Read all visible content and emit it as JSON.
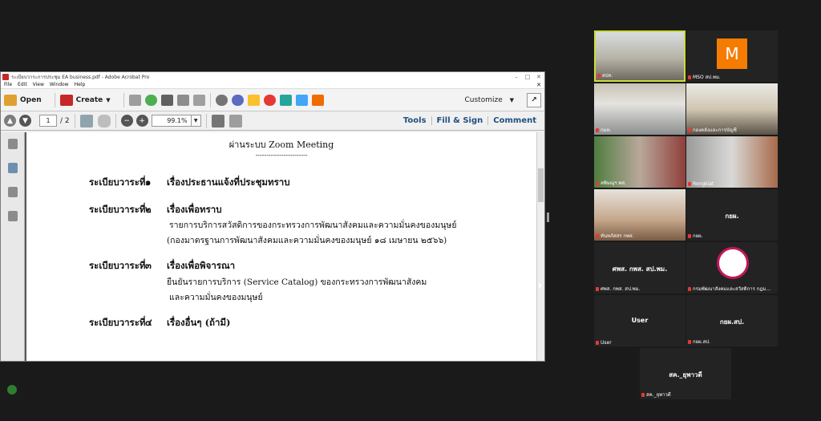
{
  "acrobat": {
    "title": "ระเบียบวาระการประชุม EA business.pdf - Adobe Acrobat Pro",
    "menu": [
      "File",
      "Edit",
      "View",
      "Window",
      "Help"
    ],
    "open_label": "Open",
    "create_label": "Create",
    "customize_label": "Customize",
    "page_current": "1",
    "page_total": "/ 2",
    "zoom": "99.1%",
    "tools_label": "Tools",
    "fillsign_label": "Fill & Sign",
    "comment_label": "Comment"
  },
  "document": {
    "heading": "ผ่านระบบ Zoom  Meeting",
    "dashes": "------------------------",
    "agenda": [
      {
        "label": "ระเบียบวาระที่",
        "num": "๑",
        "title": "เรื่องประธานแจ้งที่ประชุมทราบ",
        "details": []
      },
      {
        "label": "ระเบียบวาระที่",
        "num": "๒",
        "title": "เรื่องเพื่อทราบ",
        "details": [
          "รายการบริการสวัสดิการของกระทรวงการพัฒนาสังคมและความมั่นคงของมนุษย์",
          "(กองมาตรฐานการพัฒนาสังคมและความมั่นคงของมนุษย์ ๑๘ เมษายน ๒๕๖๖)"
        ]
      },
      {
        "label": "ระเบียบวาระที่",
        "num": "๓",
        "title": "เรื่องเพื่อพิจารณา",
        "details": [
          "ยืนยันรายการบริการ (Service Catalog) ของกระทรวงการพัฒนาสังคม",
          "และความมั่นคงของมนุษย์"
        ]
      },
      {
        "label": "ระเบียบวาระที่",
        "num": "๔",
        "title": "เรื่องอื่นๆ (ถ้ามี)",
        "details": []
      }
    ]
  },
  "participants": [
    {
      "label": "สปท.",
      "center": ""
    },
    {
      "label": "MSO สป.พม.",
      "center": "",
      "avatar_letter": "M"
    },
    {
      "label": "กมท.",
      "center": ""
    },
    {
      "label": "กองคลังและการบัญชี",
      "center": ""
    },
    {
      "label": "ลพิษณุฯ พส.",
      "center": ""
    },
    {
      "label": "Rongkiat",
      "center": ""
    },
    {
      "label": "ทันทภัสสร กพส.",
      "center": ""
    },
    {
      "label": "กยผ.",
      "center": "กยผ."
    },
    {
      "label": "ศพส. กพส. สป.พม.",
      "center": "ศพส. กพส. สป.พม."
    },
    {
      "label": "กรมพัฒนาสังคมและสวัสดิการ กฎม...",
      "center": ""
    },
    {
      "label": "User",
      "center": "User"
    },
    {
      "label": "กยผ.สป.",
      "center": "กยผ.สป."
    },
    {
      "label": "สค._ยุพาวดี",
      "center": "สค._ยุพาวดี"
    }
  ],
  "colors": {
    "accent_orange": "#f57c00",
    "active_border": "#cddc39",
    "link_blue": "#1f4f80"
  }
}
